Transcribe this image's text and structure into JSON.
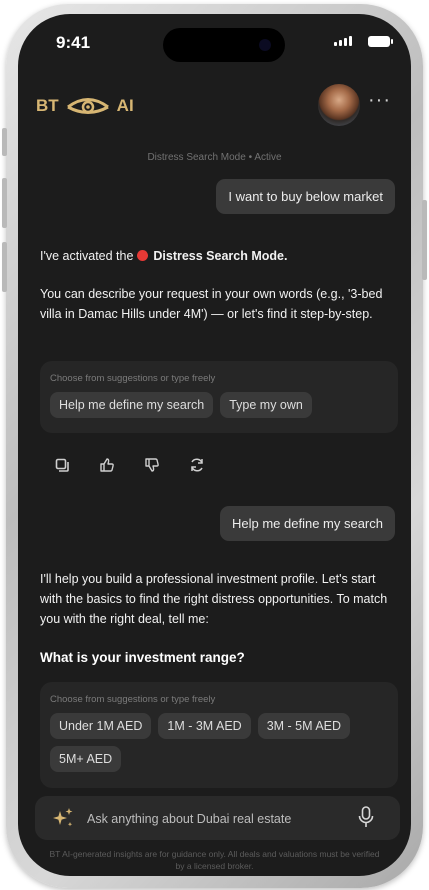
{
  "status_bar": {
    "time": "9:41"
  },
  "header": {
    "logo_left": "BT",
    "logo_right": "AI"
  },
  "chat": {
    "mode_status": "Distress Search Mode • Active",
    "user_message_1": "I want to buy below market",
    "assistant_message_1": {
      "intro_prefix": "I've activated the ",
      "mode_name": "Distress Search Mode.",
      "body": "You can describe your request in your own words (e.g., '3-bed villa in Damac Hills under 4M') — or let's find it step-by-step."
    },
    "suggestions_1": {
      "hint": "Choose from suggestions or type freely",
      "options": [
        "Help me define my search",
        "Type my own"
      ]
    },
    "message_actions": [
      "copy-icon",
      "thumbs-up-icon",
      "thumbs-down-icon",
      "regenerate-icon"
    ],
    "user_message_2": "Help me define my search",
    "assistant_message_2": {
      "body": "I'll help you build a professional investment profile. Let's start with the basics to find the right distress opportunities. To match you with the right deal, tell me:",
      "question": "What is your investment range?"
    },
    "suggestions_2": {
      "hint": "Choose from suggestions or type freely",
      "options": [
        "Under 1M AED",
        "1M - 3M AED",
        "3M - 5M AED",
        "5M+ AED"
      ]
    }
  },
  "composer": {
    "placeholder": "Ask anything about Dubai real estate"
  },
  "disclaimer": "BT AI-generated insights are for guidance only. All deals and valuations must be verified by a licensed broker.",
  "colors": {
    "accent_gold": "#d7b673",
    "background": "#1c1c1c",
    "bubble": "#3a3a3a",
    "card": "#262626",
    "red_indicator": "#e53935"
  }
}
